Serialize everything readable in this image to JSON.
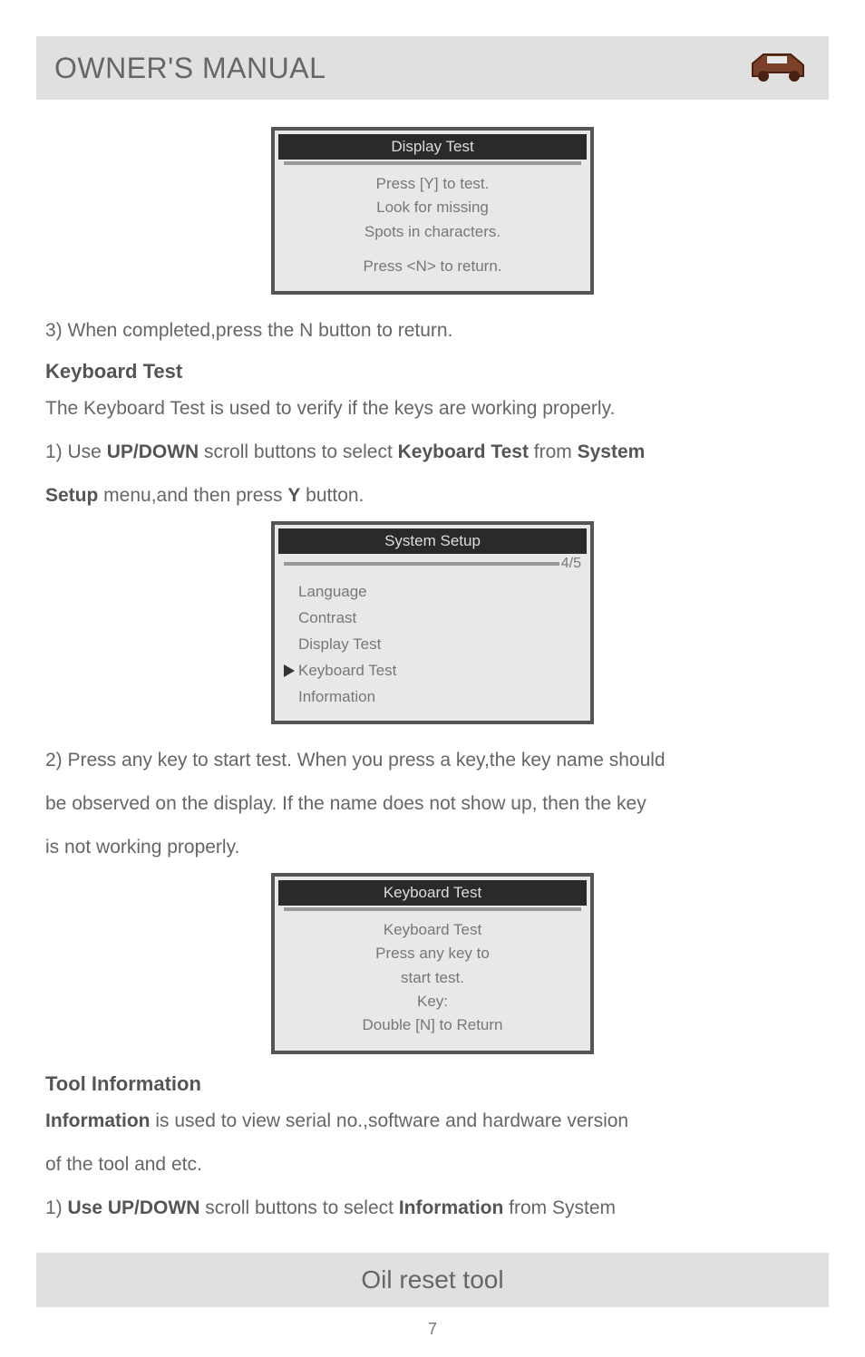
{
  "header": {
    "title": "OWNER'S MANUAL"
  },
  "display_test_box": {
    "title": "Display Test",
    "line1": "Press [Y] to test.",
    "line2": "Look for missing",
    "line3": "Spots in characters.",
    "line4": "Press <N> to return."
  },
  "step3": "3) When completed,press the N button to return.",
  "keyboard_section": {
    "heading": "Keyboard Test",
    "intro": "The Keyboard Test is used to verify if the keys are working properly.",
    "step1_pre": "1) Use ",
    "updown": "UP/DOWN",
    "step1_mid1": " scroll buttons to select ",
    "kbtest": "Keyboard Test",
    "step1_mid2": " from ",
    "system": "System",
    "setup": "Setup",
    "step1_post": " menu,and then press ",
    "y": "Y",
    "step1_end": " button."
  },
  "system_setup_box": {
    "title": "System Setup",
    "counter": "4/5",
    "items": {
      "0": "Language",
      "1": "Contrast",
      "2": "Display Test",
      "3": "Keyboard Test",
      "4": "Information"
    }
  },
  "step2_p1": "2) Press any key to start test. When you press a key,the key name should",
  "step2_p2": "be observed on the display. If the name does not show up, then the key",
  "step2_p3": "is not working properly.",
  "keyboard_test_box": {
    "title": "Keyboard Test",
    "line1": "Keyboard Test",
    "line2": "Press any key to",
    "line3": "start test.",
    "line4": "Key:",
    "line5": "Double [N] to Return"
  },
  "tool_section": {
    "heading": "Tool Information",
    "info_bold": "Information",
    "intro_rest": " is used to view serial no.,software and hardware version",
    "intro_line2": "of the tool and etc.",
    "step1_pre": "1) ",
    "use_updown": "Use UP/DOWN",
    "step1_mid": " scroll buttons to select ",
    "information": "Information",
    "step1_post": " from System"
  },
  "footer": {
    "title": "Oil reset tool"
  },
  "page_number": "7"
}
